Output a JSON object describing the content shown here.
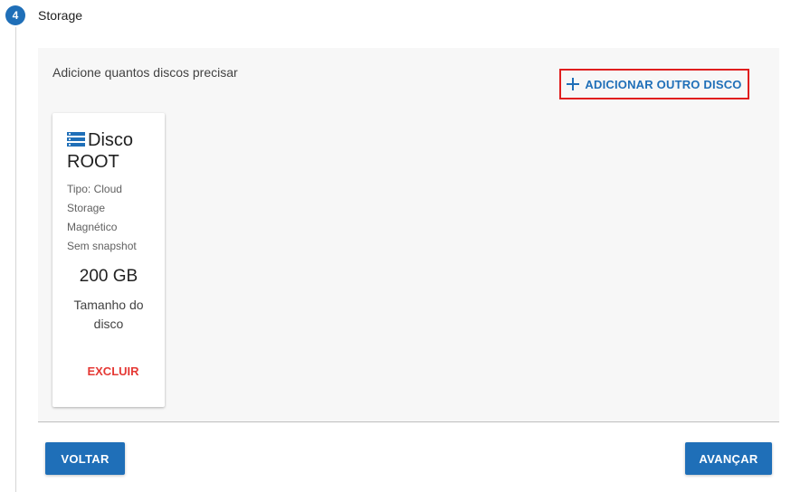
{
  "step": {
    "number": "4",
    "title": "Storage"
  },
  "panel": {
    "instructions": "Adicione quantos discos precisar",
    "add_button_label": "ADICIONAR OUTRO DISCO",
    "add_button_icon": "plus-icon"
  },
  "disk": {
    "icon": "storage-list-icon",
    "title": "Disco ROOT",
    "meta": [
      "Tipo: Cloud",
      "Storage",
      "Magnético",
      "Sem snapshot"
    ],
    "size": "200 GB",
    "size_label": "Tamanho do disco",
    "delete_label": "EXCLUIR"
  },
  "footer": {
    "back_label": "VOLTAR",
    "next_label": "AVANÇAR"
  },
  "colors": {
    "primary": "#1f6fb8",
    "danger": "#e53935",
    "highlight_border": "#e01e1e",
    "panel_bg": "#f7f7f7"
  }
}
